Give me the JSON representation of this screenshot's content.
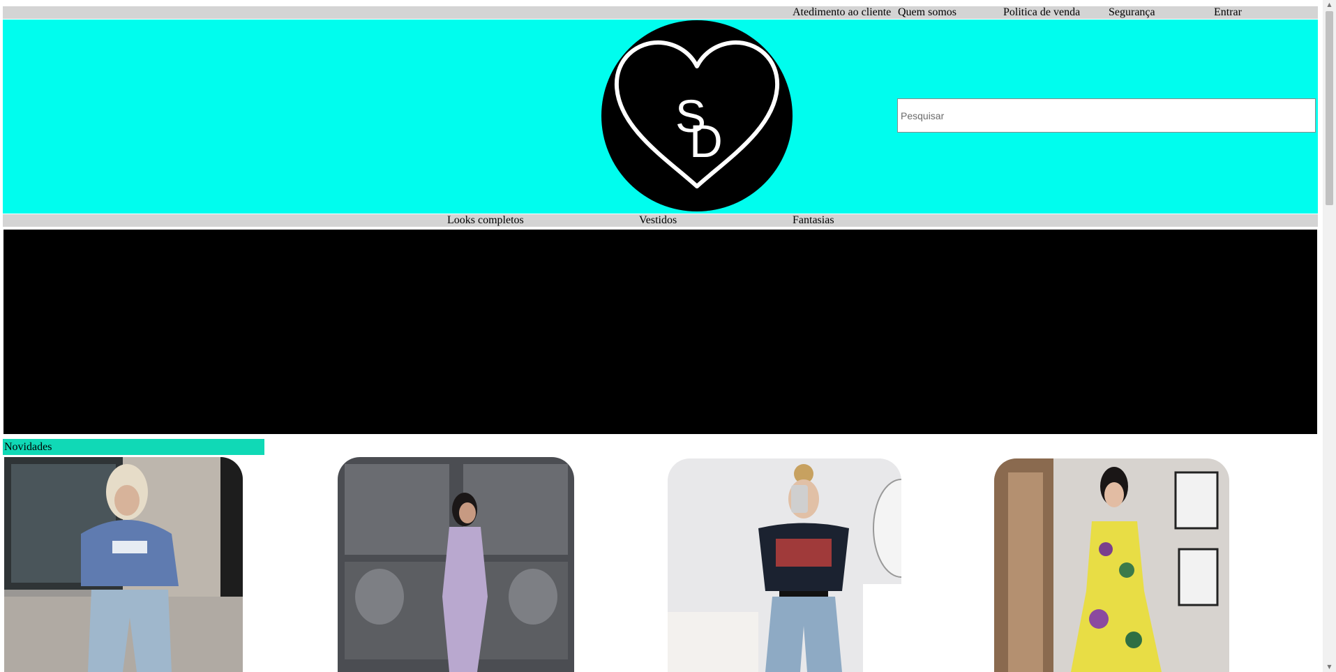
{
  "topnav": {
    "customer_service": "Atedimento ao cliente",
    "about": "Quem somos",
    "sales_policy": "Politica de venda",
    "security": "Segurança",
    "login": "Entrar"
  },
  "header": {
    "logo_text": "SD",
    "logo_icon": "heart-icon",
    "search_placeholder": "Pesquisar"
  },
  "categories": {
    "complete_looks": "Looks completos",
    "dresses": "Vestidos",
    "costumes": "Fantasias"
  },
  "section": {
    "title": "Novidades"
  },
  "products": [
    {
      "image": "woman in blue sweatshirt and jeans on street"
    },
    {
      "image": "woman in lilac dress in front of carved bronze door"
    },
    {
      "image": "woman taking mirror selfie in black t-shirt and jeans"
    },
    {
      "image": "woman in yellow floral halter dress"
    }
  ],
  "colors": {
    "header_bg": "#00fdee",
    "nav_bg": "#d4d4d4",
    "section_title_bg": "#10d9b6",
    "banner_bg": "#000000"
  }
}
